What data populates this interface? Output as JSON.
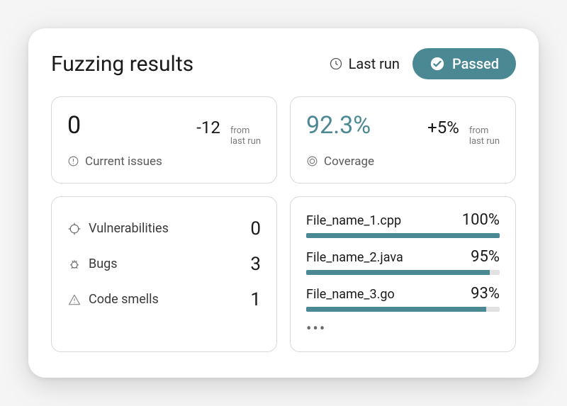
{
  "header": {
    "title": "Fuzzing results",
    "last_run_label": "Last run",
    "status_label": "Passed"
  },
  "issues": {
    "value": "0",
    "delta": "-12",
    "delta_note_1": "from",
    "delta_note_2": "last run",
    "label": "Current issues"
  },
  "coverage": {
    "value": "92.3%",
    "delta": "+5%",
    "delta_note_1": "from",
    "delta_note_2": "last run",
    "label": "Coverage"
  },
  "breakdown": {
    "vulnerabilities": {
      "label": "Vulnerabilities",
      "count": "0"
    },
    "bugs": {
      "label": "Bugs",
      "count": "3"
    },
    "smells": {
      "label": "Code smells",
      "count": "1"
    }
  },
  "files": [
    {
      "name": "File_name_1.cpp",
      "pct_label": "100%",
      "pct": 100
    },
    {
      "name": "File_name_2.java",
      "pct_label": "95%",
      "pct": 95
    },
    {
      "name": "File_name_3.go",
      "pct_label": "93%",
      "pct": 93
    }
  ],
  "more_label": "•••",
  "colors": {
    "accent": "#4a8893"
  }
}
